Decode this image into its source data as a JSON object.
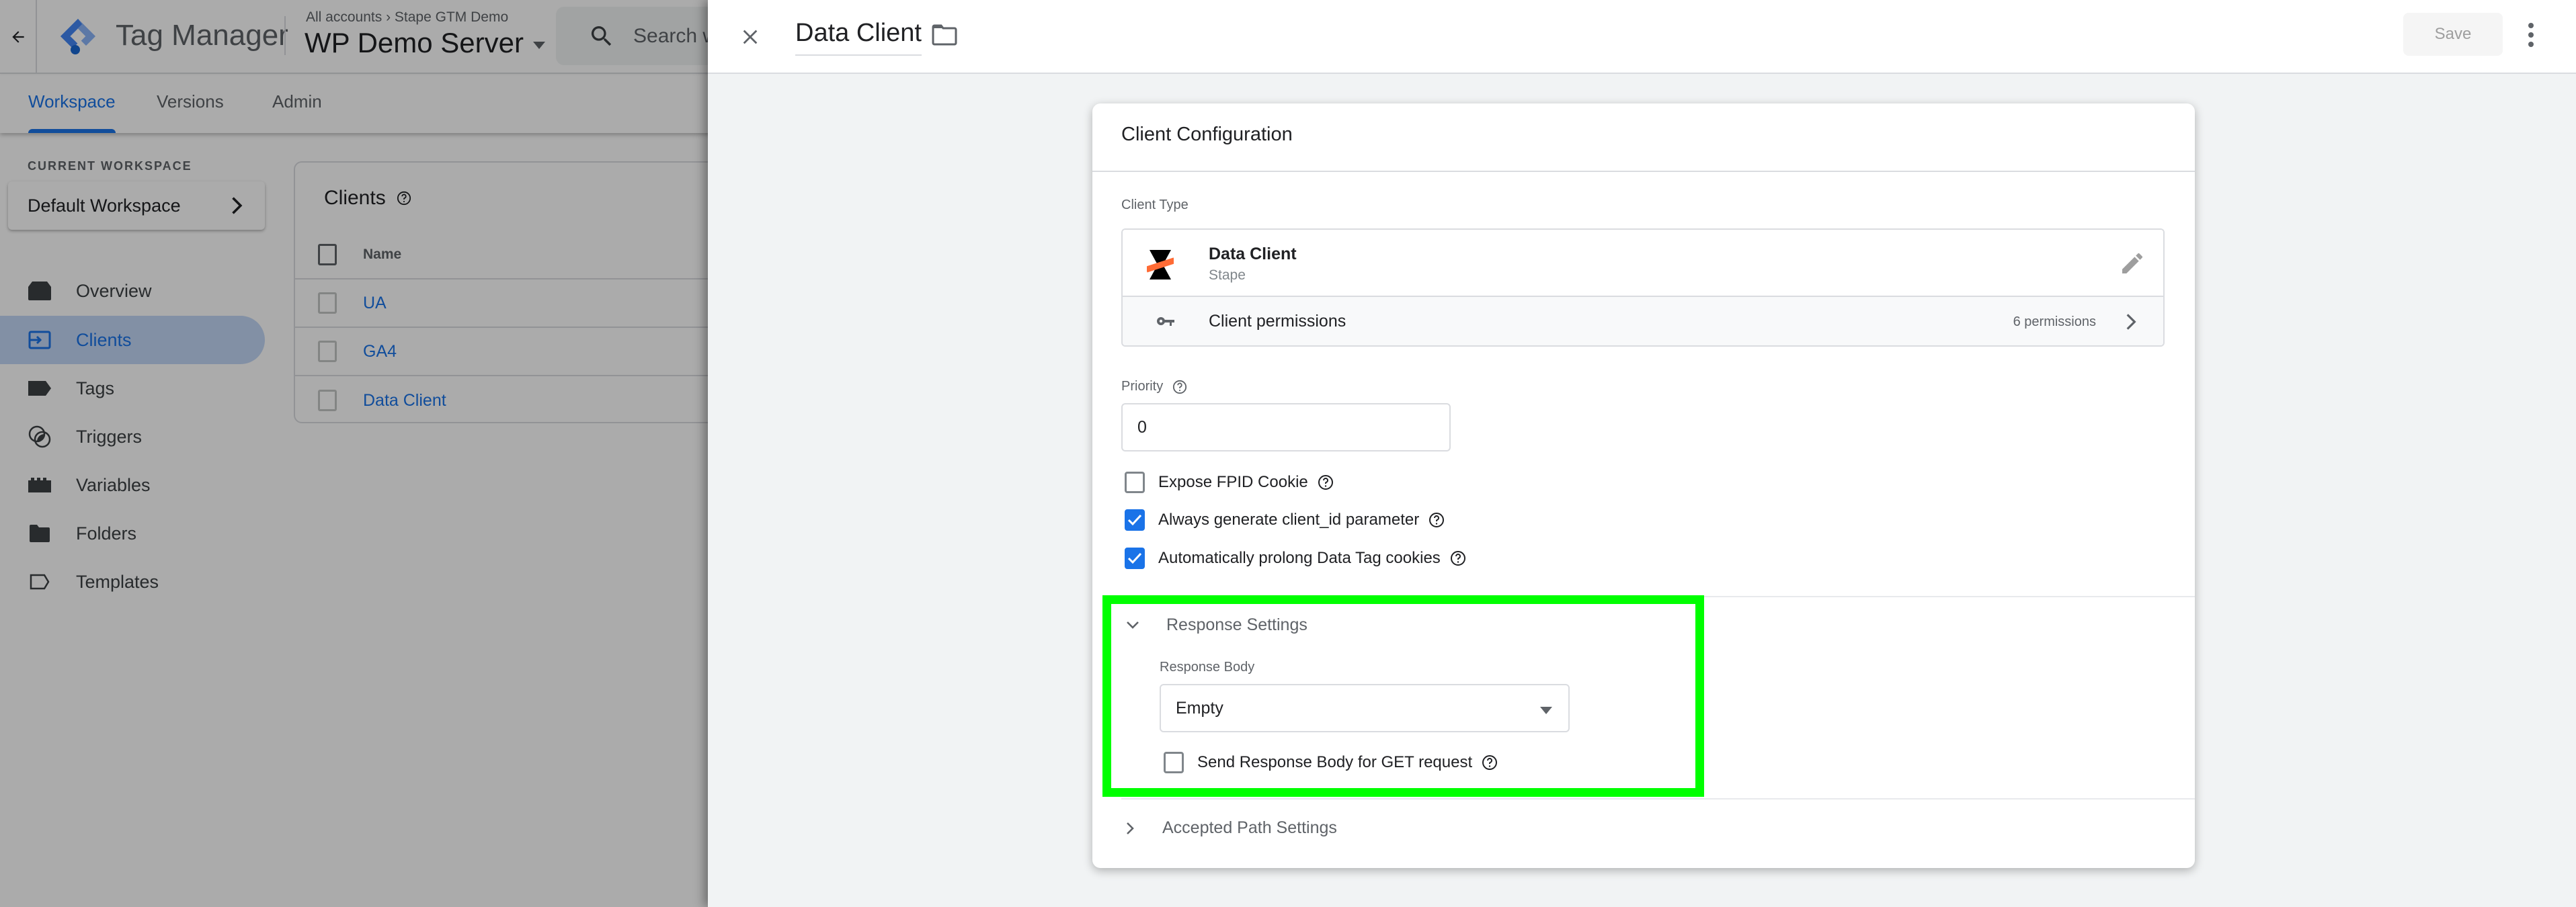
{
  "app": {
    "name": "Tag Manager",
    "breadcrumb": [
      "All accounts",
      "Stape GTM Demo"
    ],
    "container_name": "WP Demo Server",
    "search_placeholder": "Search workspace"
  },
  "tabs": [
    {
      "label": "Workspace",
      "active": true
    },
    {
      "label": "Versions",
      "active": false
    },
    {
      "label": "Admin",
      "active": false
    }
  ],
  "sidebar": {
    "workspace_label": "CURRENT WORKSPACE",
    "workspace_name": "Default Workspace",
    "items": [
      {
        "label": "Overview",
        "icon": "overview-icon",
        "active": false
      },
      {
        "label": "Clients",
        "icon": "clients-icon",
        "active": true
      },
      {
        "label": "Tags",
        "icon": "tag-icon",
        "active": false
      },
      {
        "label": "Triggers",
        "icon": "triggers-icon",
        "active": false
      },
      {
        "label": "Variables",
        "icon": "variables-icon",
        "active": false
      },
      {
        "label": "Folders",
        "icon": "folder-icon",
        "active": false
      },
      {
        "label": "Templates",
        "icon": "template-icon",
        "active": false
      }
    ]
  },
  "clients_list": {
    "title": "Clients",
    "column_header": "Name",
    "rows": [
      "UA",
      "GA4",
      "Data Client"
    ]
  },
  "panel": {
    "title": "Data Client",
    "save_label": "Save",
    "card_title": "Client Configuration",
    "client_type": {
      "label": "Client Type",
      "name": "Data Client",
      "vendor": "Stape",
      "permissions_label": "Client permissions",
      "permissions_count": "6 permissions"
    },
    "priority": {
      "label": "Priority",
      "value": "0"
    },
    "checkboxes": [
      {
        "label": "Expose FPID Cookie",
        "checked": false
      },
      {
        "label": "Always generate client_id parameter",
        "checked": true
      },
      {
        "label": "Automatically prolong Data Tag cookies",
        "checked": true
      }
    ],
    "response_settings": {
      "title": "Response Settings",
      "expanded": true,
      "body_label": "Response Body",
      "body_value": "Empty",
      "get_checkbox_label": "Send Response Body for GET request",
      "get_checkbox_checked": false
    },
    "accepted_path": {
      "title": "Accepted Path Settings",
      "expanded": false
    }
  },
  "colors": {
    "accent": "#1a73e8",
    "highlight": "#00ff00",
    "stape_orange": "#ff6b35"
  }
}
